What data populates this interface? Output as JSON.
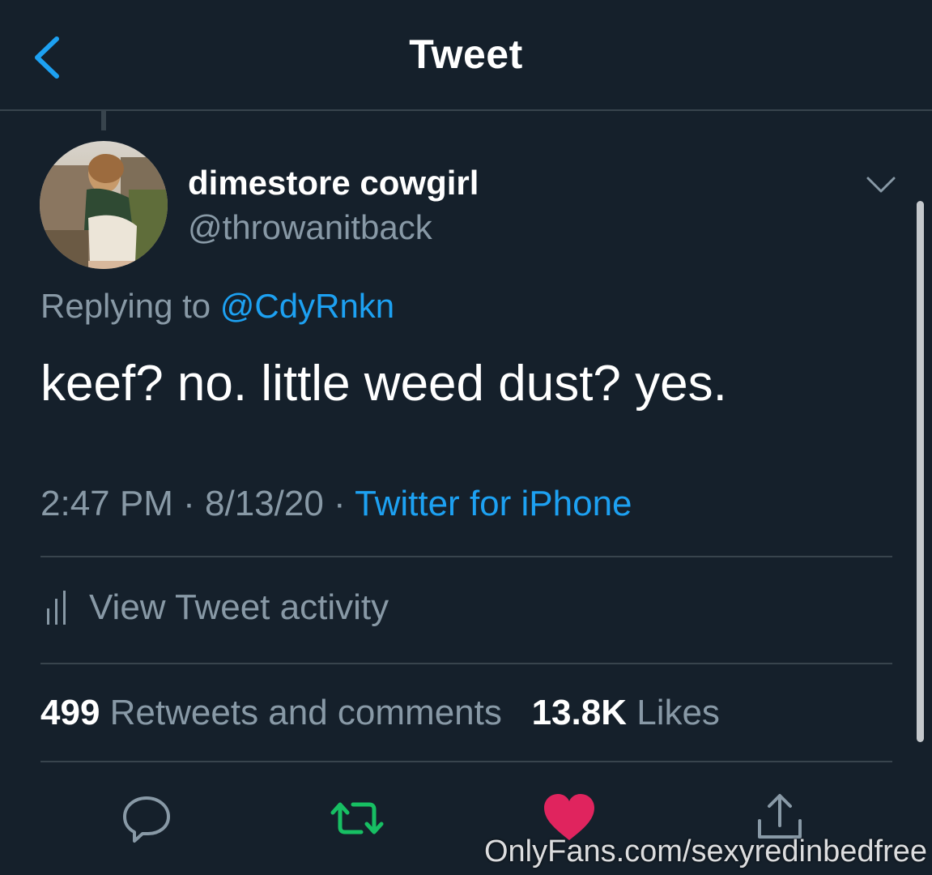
{
  "header": {
    "title": "Tweet",
    "back_icon": "chevron-left-icon"
  },
  "tweet": {
    "author": {
      "display_name": "dimestore cowgirl",
      "handle": "@throwanitback"
    },
    "replying_to": {
      "prefix": "Replying to",
      "mention": "@CdyRnkn"
    },
    "text": "keef? no. little weed dust? yes.",
    "time": "2:47 PM",
    "date": "8/13/20",
    "source": "Twitter for iPhone",
    "separator": "·"
  },
  "activity": {
    "label": "View Tweet activity",
    "icon": "bar-chart-icon"
  },
  "stats": {
    "retweets_count": "499",
    "retweets_label": "Retweets and comments",
    "likes_count": "13.8K",
    "likes_label": "Likes"
  },
  "actions": {
    "reply_icon": "reply-icon",
    "retweet_icon": "retweet-icon",
    "like_icon": "heart-icon",
    "share_icon": "share-icon"
  },
  "watermark": "OnlyFans.com/sexyredinbedfree",
  "colors": {
    "background": "#15202b",
    "divider": "#38444d",
    "secondary_text": "#8899a6",
    "accent_blue": "#1da1f2",
    "retweet_green": "#17bf63",
    "like_red": "#e0245e"
  }
}
